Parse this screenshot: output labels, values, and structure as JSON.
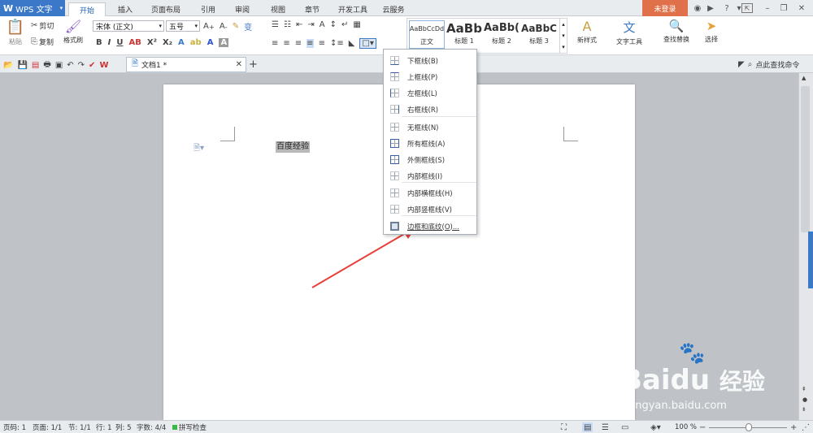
{
  "app": {
    "name": "WPS 文字",
    "login_label": "未登录"
  },
  "tabs": [
    "开始",
    "插入",
    "页面布局",
    "引用",
    "审阅",
    "视图",
    "章节",
    "开发工具",
    "云服务"
  ],
  "active_tab": "开始",
  "ribbon": {
    "paste": "粘贴",
    "cut": "剪切",
    "copy": "复制",
    "format_painter": "格式刷",
    "font_name": "宋体 (正文)",
    "font_size": "五号",
    "styles": [
      {
        "preview": "AaBbCcDd",
        "label": "正文"
      },
      {
        "preview": "AaBb",
        "label": "标题 1"
      },
      {
        "preview": "AaBb(",
        "label": "标题 2"
      },
      {
        "preview": "AaBbC",
        "label": "标题 3"
      }
    ],
    "new_style": "新样式",
    "text_tools": "文字工具",
    "find_replace": "查找替换",
    "select": "选择"
  },
  "quick": {
    "doc_tab": "文档1 *",
    "search_cmd": "点此查找命令"
  },
  "document": {
    "text": "百度经验"
  },
  "border_menu": {
    "items": [
      "下框线(B)",
      "上框线(P)",
      "左框线(L)",
      "右框线(R)",
      "无框线(N)",
      "所有框线(A)",
      "外侧框线(S)",
      "内部框线(I)",
      "内部横框线(H)",
      "内部竖框线(V)",
      "边框和底纹(O)..."
    ]
  },
  "status": {
    "page_code": "页码: 1",
    "pages": "页面: 1/1",
    "section": "节: 1/1",
    "row": "行: 1",
    "col": "列: 5",
    "words": "字数: 4/4",
    "spell": "拼写检查",
    "zoom": "100 %"
  },
  "watermark": {
    "brand": "Bai",
    "brand2": "du",
    "cn": "经验",
    "url": "jingyan.baidu.com"
  },
  "colors": {
    "accent": "#3b78c8",
    "login": "#e0704a",
    "arrow": "#e8413a"
  }
}
